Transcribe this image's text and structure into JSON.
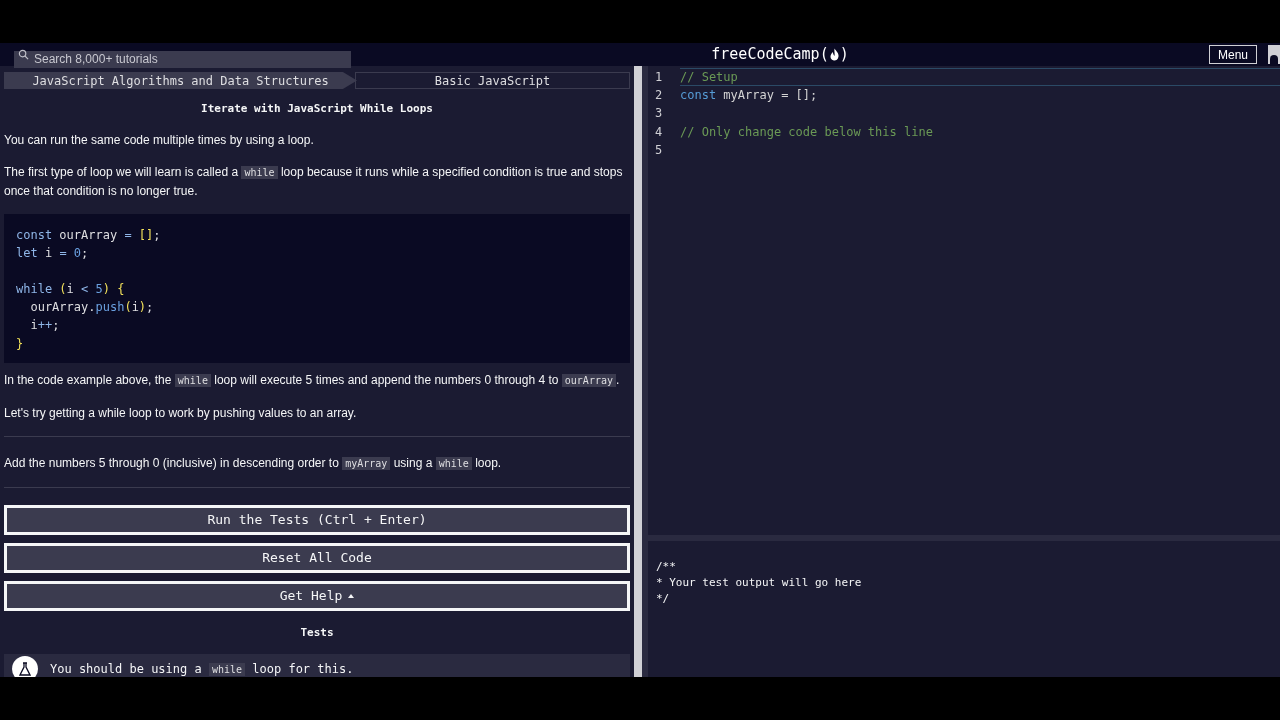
{
  "nav": {
    "search": {
      "placeholder": "Search 8,000+ tutorials"
    },
    "logo": {
      "before": "freeCodeCamp(",
      "after": ")"
    },
    "menu": "Menu"
  },
  "breadcrumbs": [
    {
      "label": "JavaScript Algorithms and Data Structures"
    },
    {
      "label": "Basic JavaScript"
    }
  ],
  "lesson": {
    "title": "Iterate with JavaScript While Loops",
    "blocks": [
      {
        "kind": "para",
        "parts": [
          {
            "kind": "text",
            "text": "You can run the same code multiple times by using a loop."
          }
        ]
      },
      {
        "kind": "para",
        "parts": [
          {
            "kind": "text",
            "text": "The first type of loop we will learn is called a "
          },
          {
            "kind": "code",
            "text": "while"
          },
          {
            "kind": "text",
            "text": " loop because it runs while a specified condition is true and stops once that condition is no longer true."
          }
        ]
      },
      {
        "kind": "code",
        "lines": [
          {
            "kind": "line",
            "tokens": [
              {
                "kind": "kw",
                "text": "const"
              },
              {
                "kind": "id",
                "text": " ourArray "
              },
              {
                "kind": "op",
                "text": "= "
              },
              {
                "kind": "br",
                "text": "[]"
              },
              {
                "kind": "id",
                "text": ";"
              }
            ]
          },
          {
            "kind": "line",
            "tokens": [
              {
                "kind": "kw",
                "text": "let"
              },
              {
                "kind": "id",
                "text": " i "
              },
              {
                "kind": "op",
                "text": "= "
              },
              {
                "kind": "num",
                "text": "0"
              },
              {
                "kind": "id",
                "text": ";"
              }
            ]
          },
          {
            "kind": "blank"
          },
          {
            "kind": "line",
            "tokens": [
              {
                "kind": "kw",
                "text": "while "
              },
              {
                "kind": "br",
                "text": "("
              },
              {
                "kind": "id",
                "text": "i "
              },
              {
                "kind": "op",
                "text": "< "
              },
              {
                "kind": "num",
                "text": "5"
              },
              {
                "kind": "br",
                "text": ") {"
              }
            ]
          },
          {
            "kind": "line",
            "tokens": [
              {
                "kind": "id",
                "text": "  ourArray."
              },
              {
                "kind": "fn",
                "text": "push"
              },
              {
                "kind": "br",
                "text": "("
              },
              {
                "kind": "id",
                "text": "i"
              },
              {
                "kind": "br",
                "text": ")"
              },
              {
                "kind": "id",
                "text": ";"
              }
            ]
          },
          {
            "kind": "line",
            "tokens": [
              {
                "kind": "id",
                "text": "  i"
              },
              {
                "kind": "op",
                "text": "++"
              },
              {
                "kind": "id",
                "text": ";"
              }
            ]
          },
          {
            "kind": "line",
            "tokens": [
              {
                "kind": "br",
                "text": "}"
              }
            ]
          }
        ]
      },
      {
        "kind": "para",
        "parts": [
          {
            "kind": "text",
            "text": "In the code example above, the "
          },
          {
            "kind": "code",
            "text": "while"
          },
          {
            "kind": "text",
            "text": " loop will execute 5 times and append the numbers 0 through 4 to "
          },
          {
            "kind": "code",
            "text": "ourArray"
          },
          {
            "kind": "text",
            "text": "."
          }
        ]
      },
      {
        "kind": "para",
        "parts": [
          {
            "kind": "text",
            "text": "Let's try getting a while loop to work by pushing values to an array."
          }
        ]
      },
      {
        "kind": "rule"
      },
      {
        "kind": "para",
        "parts": [
          {
            "kind": "text",
            "text": "Add the numbers 5 through 0 (inclusive) in descending order to "
          },
          {
            "kind": "code",
            "text": "myArray"
          },
          {
            "kind": "text",
            "text": " using a "
          },
          {
            "kind": "code",
            "text": "while"
          },
          {
            "kind": "text",
            "text": " loop."
          }
        ]
      },
      {
        "kind": "rule"
      }
    ],
    "buttons": [
      {
        "label": "Run the Tests (Ctrl + Enter)",
        "caret": false
      },
      {
        "label": "Reset All Code",
        "caret": false
      },
      {
        "label": "Get Help",
        "caret": true
      }
    ],
    "tests_title": "Tests",
    "tests": [
      {
        "parts": [
          {
            "kind": "text",
            "text": "You should be using a "
          },
          {
            "kind": "code",
            "text": "while"
          },
          {
            "kind": "text",
            "text": " loop for this."
          }
        ]
      }
    ]
  },
  "editor": {
    "lines": [
      {
        "number": "1",
        "current": true,
        "tokens": [
          {
            "kind": "comment",
            "text": "// Setup"
          }
        ]
      },
      {
        "number": "2",
        "current": false,
        "tokens": [
          {
            "kind": "kw",
            "text": "const"
          },
          {
            "kind": "id",
            "text": " myArray = [];"
          }
        ]
      },
      {
        "number": "3",
        "current": false
      },
      {
        "number": "4",
        "current": false,
        "tokens": [
          {
            "kind": "comment",
            "text": "// Only change code below this line"
          }
        ]
      },
      {
        "number": "5",
        "current": false
      }
    ]
  },
  "output": {
    "lines": [
      "/**",
      "* Your test output will go here",
      "*/"
    ]
  }
}
